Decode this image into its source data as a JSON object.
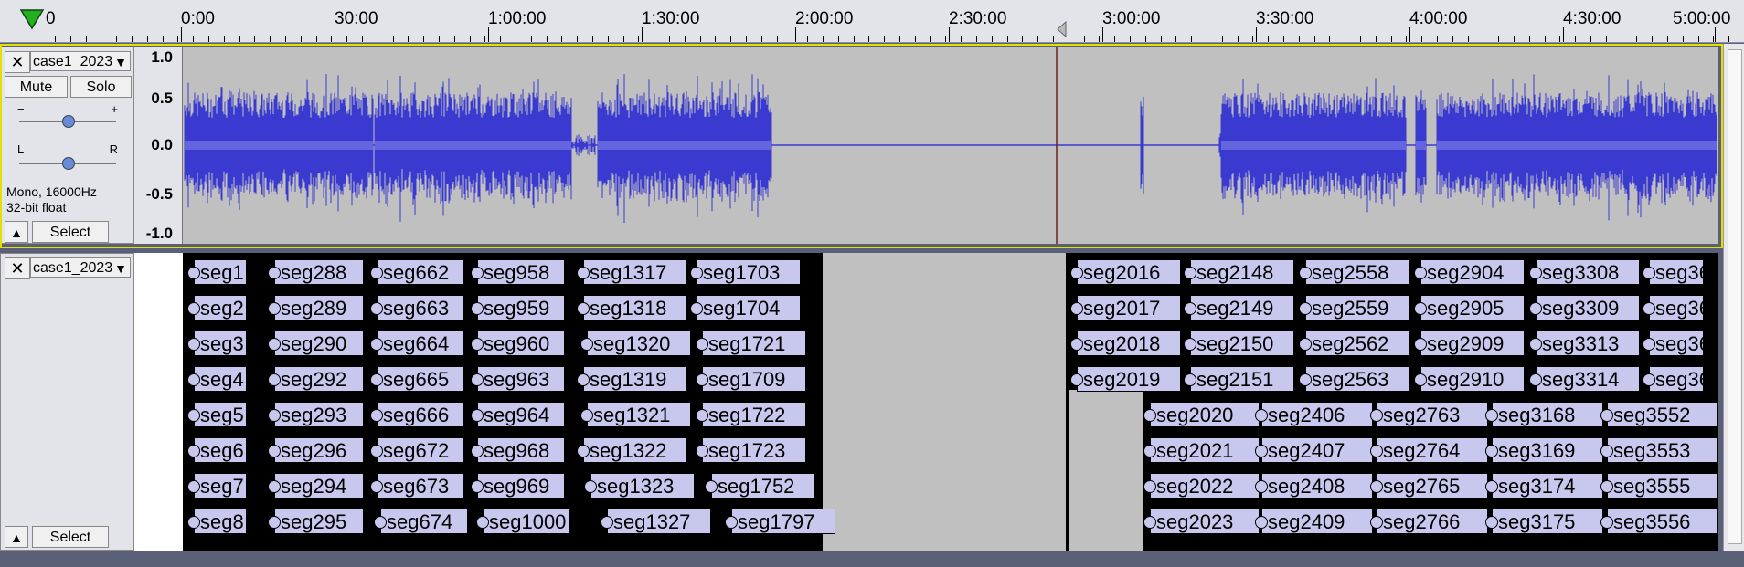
{
  "ruler": {
    "ticks": [
      "0",
      "0:00",
      "30:00",
      "1:00:00",
      "1:30:00",
      "2:00:00",
      "2:30:00",
      "3:00:00",
      "3:30:00",
      "4:00:00",
      "4:30:00",
      "5:00:00"
    ]
  },
  "audio_track": {
    "close": "✕",
    "name": "case1_2023",
    "mute": "Mute",
    "solo": "Solo",
    "gain_minus": "−",
    "gain_plus": "+",
    "pan_left": "L",
    "pan_right": "R",
    "format": "Mono, 16000Hz",
    "bit_depth": "32-bit float",
    "select": "Select",
    "vruler": [
      "1.0",
      "0.5",
      "0.0",
      "-0.5",
      "-1.0"
    ]
  },
  "label_track": {
    "close": "✕",
    "name": "case1_2023",
    "select": "Select",
    "rows": [
      [
        "seg1",
        "seg288",
        "seg662",
        "seg958",
        "seg1317",
        "seg1703",
        "seg2016",
        "seg2148",
        "seg2558",
        "seg2904",
        "seg3308",
        "seg36"
      ],
      [
        "seg2",
        "seg289",
        "seg663",
        "seg959",
        "seg1318",
        "seg1704",
        "seg2017",
        "seg2149",
        "seg2559",
        "seg2905",
        "seg3309",
        "seg36"
      ],
      [
        "seg3",
        "seg290",
        "seg664",
        "seg960",
        "seg1320",
        "seg1721",
        "seg2018",
        "seg2150",
        "seg2562",
        "seg2909",
        "seg3313",
        "seg36"
      ],
      [
        "seg4",
        "seg292",
        "seg665",
        "seg963",
        "seg1319",
        "seg1709",
        "seg2019",
        "seg2151",
        "seg2563",
        "seg2910",
        "seg3314",
        "seg36"
      ],
      [
        "seg5",
        "seg293",
        "seg666",
        "seg964",
        "seg1321",
        "seg1722",
        "seg2020",
        "seg2406",
        "seg2763",
        "seg3168",
        "seg3552"
      ],
      [
        "seg6",
        "seg296",
        "seg672",
        "seg968",
        "seg1322",
        "seg1723",
        "seg2021",
        "seg2407",
        "seg2764",
        "seg3169",
        "seg3553"
      ],
      [
        "seg7",
        "seg294",
        "seg673",
        "seg969",
        "seg1323",
        "seg1752",
        "seg2022",
        "seg2408",
        "seg2765",
        "seg3174",
        "seg3555"
      ],
      [
        "seg8",
        "seg295",
        "seg674",
        "seg1000",
        "seg1327",
        "seg1797",
        "seg2023",
        "seg2409",
        "seg2766",
        "seg3175",
        "seg3556"
      ]
    ]
  },
  "colors": {
    "waveform": "#3a3ad0",
    "track_bg": "#c0c0c0",
    "label_bg": "#c8c8ee",
    "selected_border": "#e2e000"
  }
}
